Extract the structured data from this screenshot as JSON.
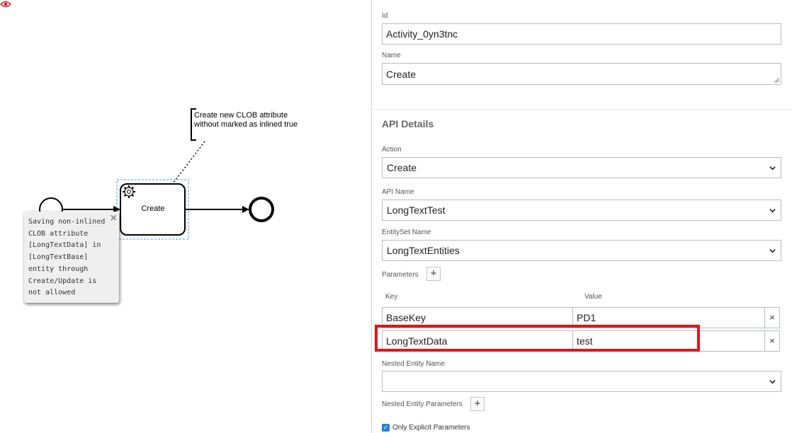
{
  "canvas": {
    "task_name": "Create",
    "annotation_lines": [
      "Create new CLOB attribute",
      "without marked as inlined true"
    ],
    "tooltip_text": "Saving non-inlined\nCLOB attribute\n[LongTextData] in\n[LongTextBase]\nentity through\nCreate/Update is\nnot allowed",
    "tooltip_close": "×"
  },
  "panel": {
    "id_label": "Id",
    "id_value": "Activity_0yn3tnc",
    "name_label": "Name",
    "name_value": "Create",
    "section_title": "API Details",
    "action_label": "Action",
    "action_value": "Create",
    "api_name_label": "API Name",
    "api_name_value": "LongTextTest",
    "entityset_label": "EntitySet Name",
    "entityset_value": "LongTextEntities",
    "parameters_label": "Parameters",
    "add_symbol": "+",
    "key_header": "Key",
    "value_header": "Value",
    "parameters": [
      {
        "key": "BaseKey",
        "value": "PD1"
      },
      {
        "key": "LongTextData",
        "value": "test"
      }
    ],
    "delete_symbol": "×",
    "nested_entity_label": "Nested Entity Name",
    "nested_entity_value": "",
    "nested_params_label": "Nested Entity Parameters",
    "only_explicit_label": "Only Explicit Parameters",
    "only_explicit_checked": true
  },
  "colors": {
    "highlight": "#e0161c",
    "warning": "#e0161c",
    "selection": "#4a9fe0",
    "checkbox": "#2b7cd3"
  },
  "icons": [
    "gear-icon",
    "eye-warning-icon",
    "close-icon",
    "chevron-down-icon",
    "plus-icon",
    "delete-icon",
    "check-icon"
  ]
}
